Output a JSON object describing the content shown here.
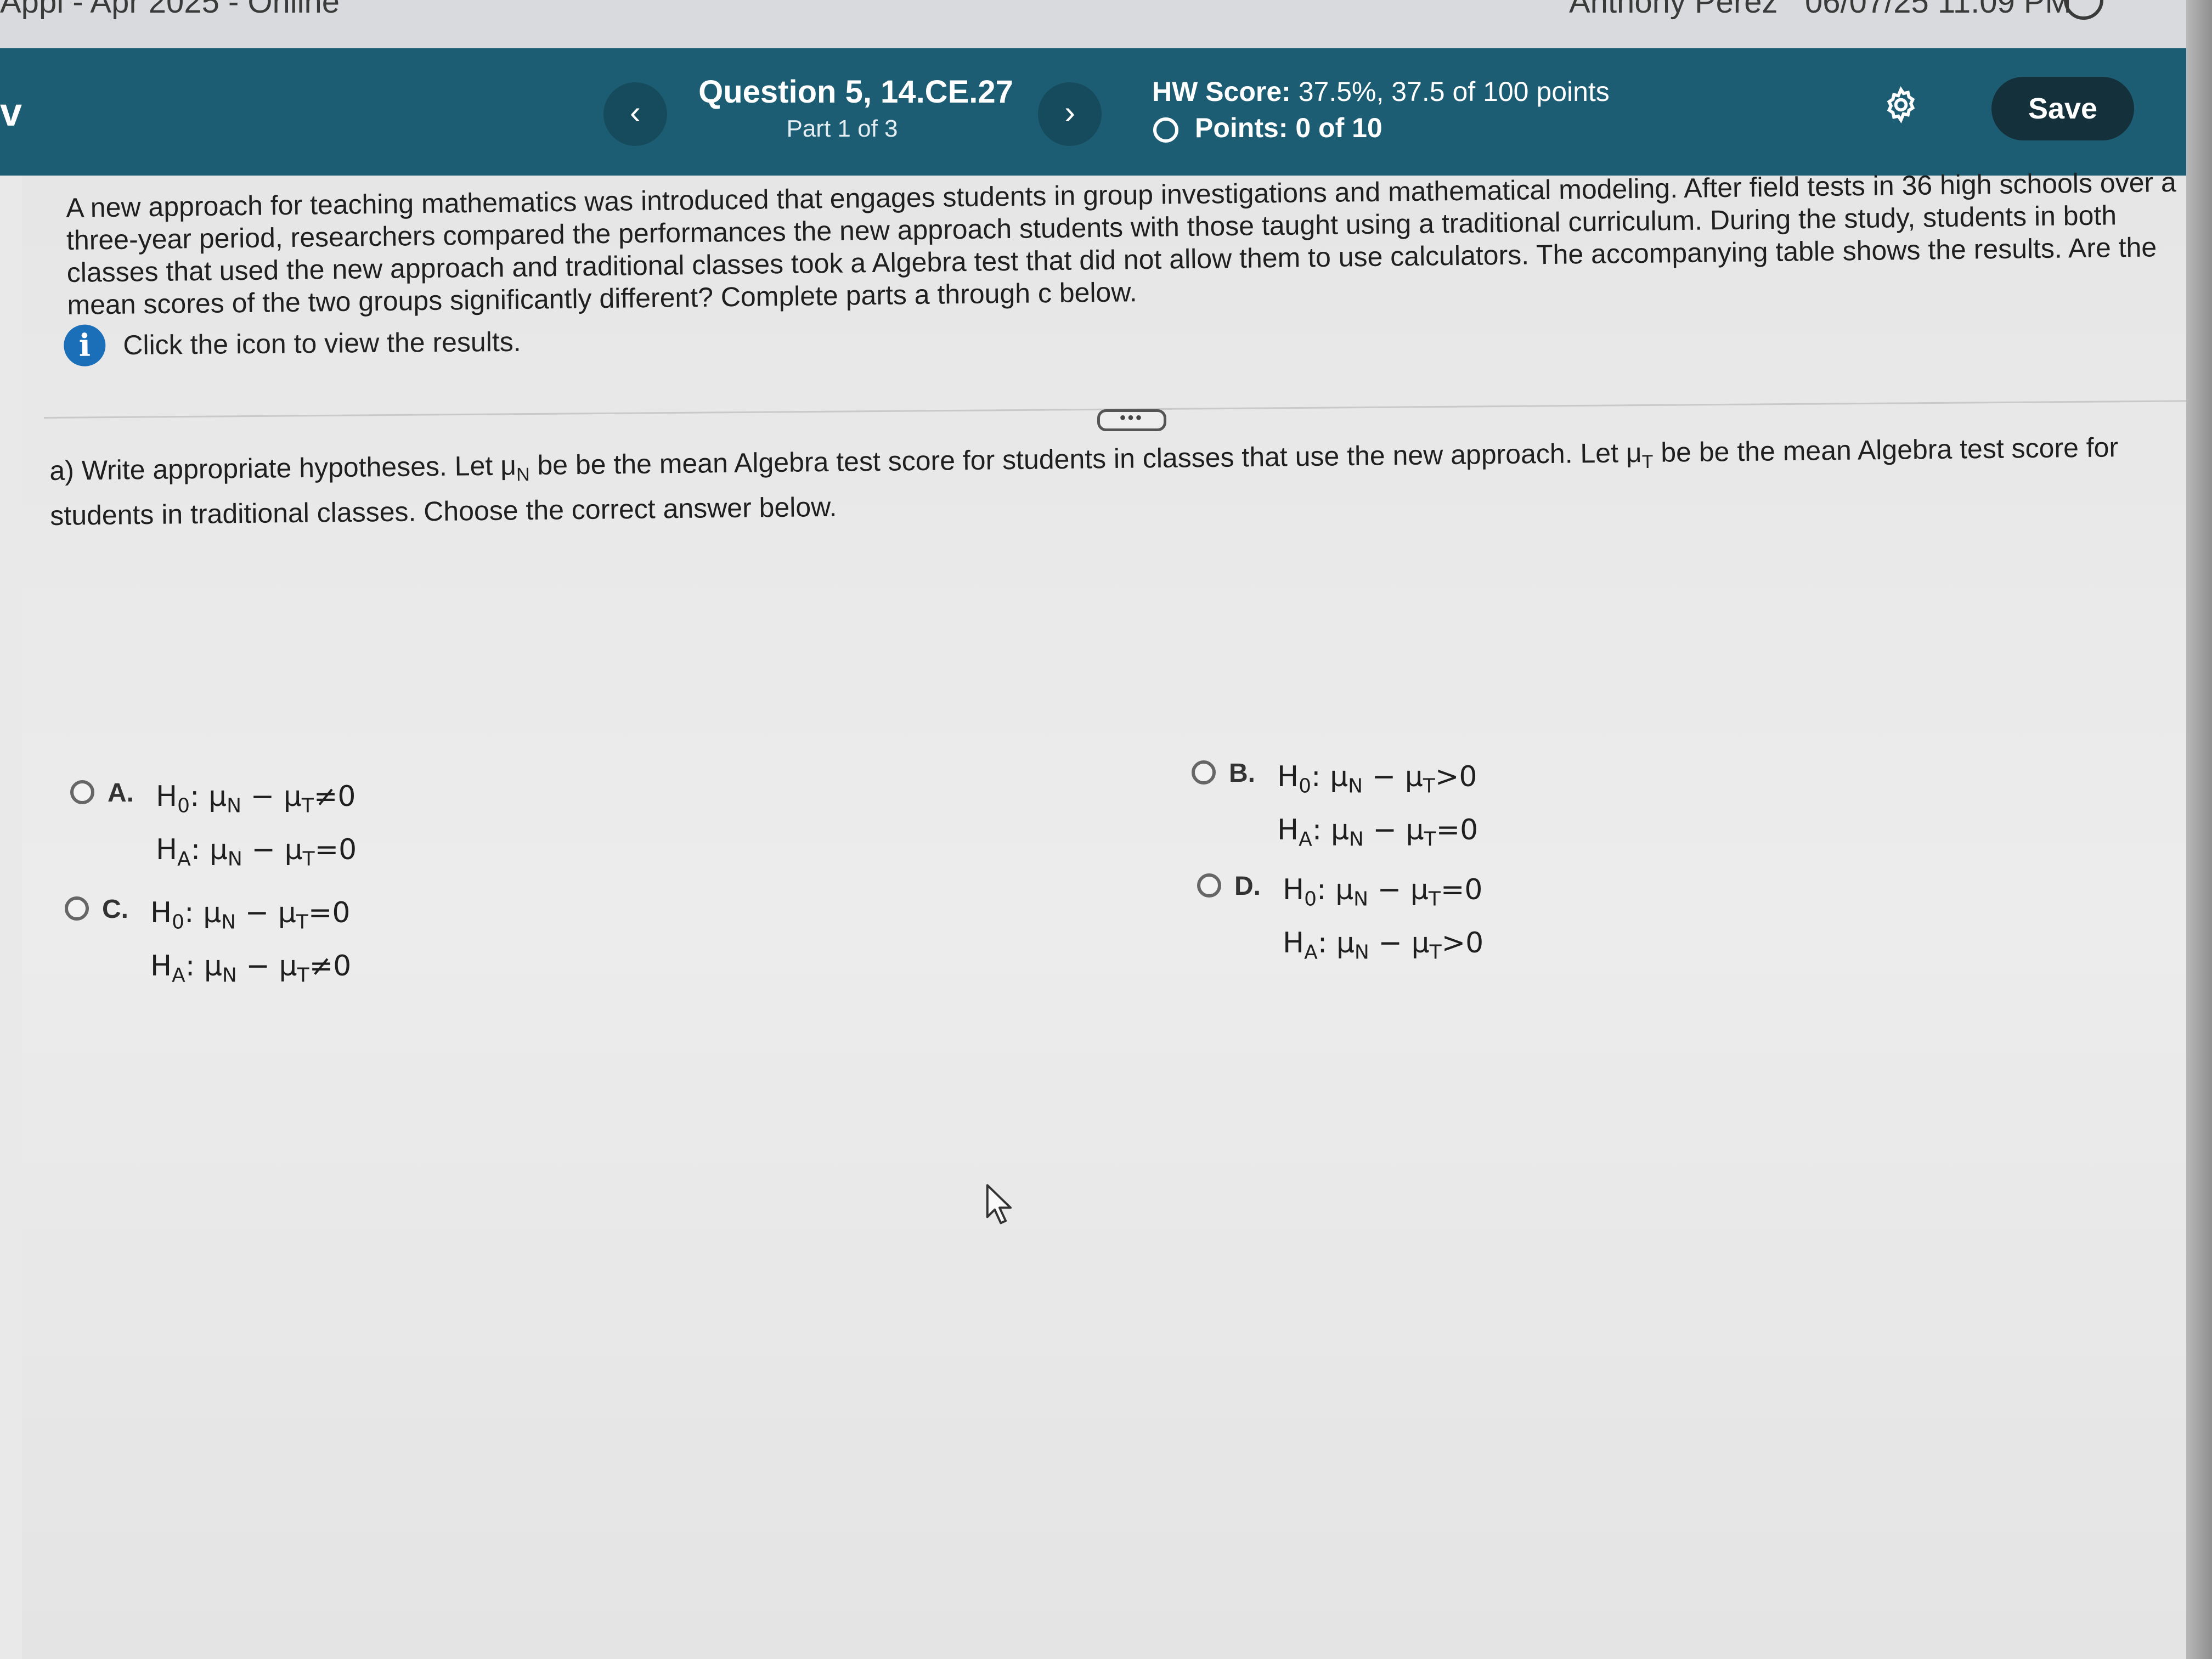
{
  "top_bar": {
    "course": "Appl - Apr 2025 - Online",
    "user": "Anthony Perez",
    "datetime": "06/07/25 11:09 PM"
  },
  "header": {
    "menu_glyph": "v",
    "prev_label": "‹",
    "next_label": "›",
    "question_title": "Question 5, 14.CE.27",
    "part": "Part 1 of 3",
    "hw_score_label": "HW Score:",
    "hw_score_value": "37.5%, 37.5 of 100 points",
    "points_label": "Points:",
    "points_value": "0 of 10",
    "save_label": "Save"
  },
  "question": {
    "intro": "A new approach for teaching mathematics was introduced that engages students in group investigations and mathematical modeling. After field tests in 36 high schools over a three-year period, researchers compared the performances the new approach students with those taught using a traditional curriculum. During the study, students in both classes that used the new approach and traditional classes took a Algebra test that did not allow them to use calculators. The accompanying table shows the results. Are the mean scores of the two groups significantly different? Complete parts a through c below.",
    "info_text": "Click the icon to view the results.",
    "divider_handle": "•••"
  },
  "part_a": {
    "text_1": "a) Write appropriate hypotheses. Let μ",
    "sub_n": "N",
    "text_2": " be be the mean Algebra test score for students in classes that use the new approach. Let μ",
    "sub_t": "T",
    "text_3": " be be the mean Algebra test score for students in traditional classes. Choose the correct answer below."
  },
  "options": [
    {
      "letter": "A.",
      "h0_rel": "≠0",
      "ha_rel": "=0"
    },
    {
      "letter": "B.",
      "h0_rel": ">0",
      "ha_rel": "=0"
    },
    {
      "letter": "C.",
      "h0_rel": "=0",
      "ha_rel": "≠0"
    },
    {
      "letter": "D.",
      "h0_rel": "=0",
      "ha_rel": ">0"
    }
  ],
  "symbols": {
    "h": "H",
    "h0_sub": "0",
    "ha_sub": "A",
    "colon": ": ",
    "mu": "μ",
    "n": "N",
    "t": "T",
    "minus": " − "
  },
  "colors": {
    "header_bg": "#1d5d73",
    "save_bg": "#14303b",
    "info_icon": "#1a6fb8"
  },
  "icons": [
    "chevron-left-icon",
    "chevron-right-icon",
    "gear-icon",
    "info-icon",
    "cursor-icon",
    "help-icon"
  ]
}
